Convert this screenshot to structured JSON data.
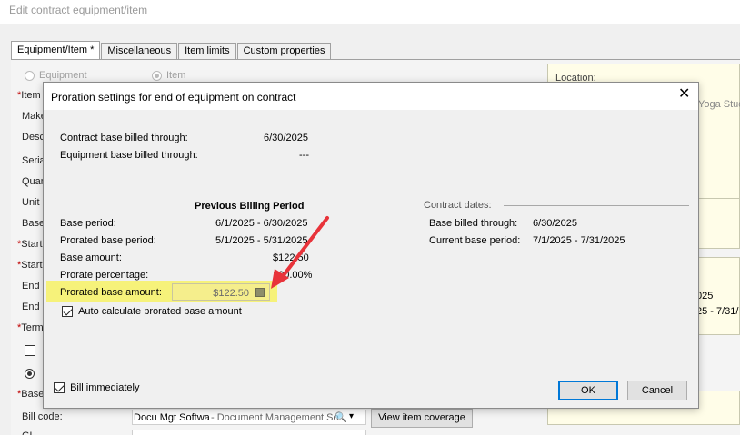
{
  "window": {
    "title": "Edit contract equipment/item"
  },
  "tabs": [
    {
      "label": "Equipment/Item *"
    },
    {
      "label": "Miscellaneous"
    },
    {
      "label": "Item limits"
    },
    {
      "label": "Custom properties"
    }
  ],
  "type_options": {
    "equipment": "Equipment",
    "item": "Item"
  },
  "form_labels": {
    "item": "Item",
    "make": "Make",
    "desc": "Desc",
    "serial": "Seria",
    "quantity": "Quan",
    "unit": "Unit",
    "base": "Base",
    "start1": "Start",
    "start2": "Start",
    "end1": "End",
    "end2": "End",
    "term": "Term",
    "base_req": "Base",
    "bill_code": "Bill code:",
    "gl": "GL"
  },
  "bill_code": {
    "value": "Docu Mgt Softwa",
    "desc": " - Document Management So"
  },
  "buttons_bg": {
    "view_item_coverage": "View item coverage"
  },
  "right_panel": {
    "location_label": "Location:",
    "customer_text": "Yoga Stud",
    "date1": "025",
    "date2": "25 - 7/31/"
  },
  "dialog": {
    "title": "Proration settings for end of equipment on contract",
    "contract_billed_label": "Contract base billed through:",
    "contract_billed_value": "6/30/2025",
    "equipment_billed_label": "Equipment base billed through:",
    "equipment_billed_value": "---",
    "previous_header": "Previous Billing Period",
    "base_period_label": "Base period:",
    "base_period_value": "6/1/2025 - 6/30/2025",
    "prorated_period_label": "Prorated base period:",
    "prorated_period_value": "5/1/2025 - 5/31/2025",
    "base_amount_label": "Base amount:",
    "base_amount_value": "$122.50",
    "prorate_pct_label": "Prorate percentage:",
    "prorate_pct_value": "100.00%",
    "prorated_amount_label": "Prorated base amount:",
    "prorated_amount_value": "$122.50",
    "auto_calc_label": "Auto calculate prorated base amount",
    "auto_calc_checked": true,
    "contract_dates_header": "Contract dates:",
    "base_billed_through_label": "Base billed through:",
    "base_billed_through_value": "6/30/2025",
    "current_base_period_label": "Current base period:",
    "current_base_period_value": "7/1/2025 - 7/31/2025",
    "bill_immediately_label": "Bill immediately",
    "bill_immediately_checked": true,
    "ok_label": "OK",
    "cancel_label": "Cancel"
  },
  "colors": {
    "highlight": "#f6f27a",
    "arrow": "#e8333a",
    "default_button_border": "#0078d7"
  }
}
